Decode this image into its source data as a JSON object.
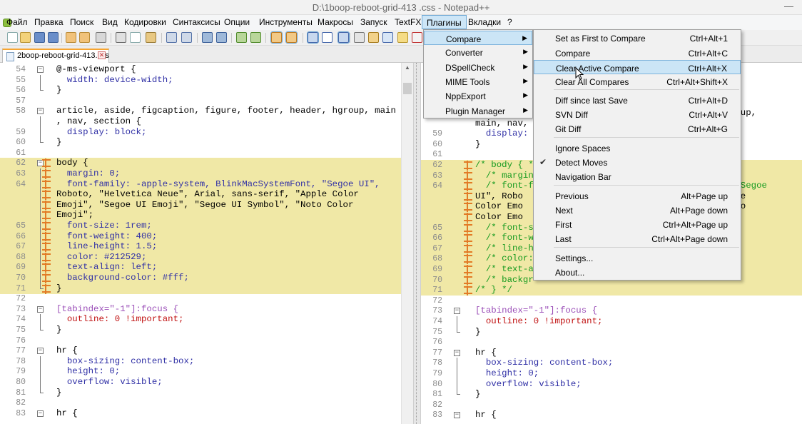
{
  "window": {
    "title": "D:\\1boop-reboot-grid-413 .css - Notepad++"
  },
  "menubar": [
    "Файл",
    "Правка",
    "Поиск",
    "Вид",
    "Кодировки",
    "Синтаксисы",
    "Опции",
    "Инструменты",
    "Макросы",
    "Запуск",
    "TextFX",
    "Плагины",
    "Вкладки",
    "?"
  ],
  "tab": {
    "label": "2boop-reboot-grid-413.css"
  },
  "plugins_menu": [
    {
      "label": "Compare",
      "arrow": "▶"
    },
    {
      "label": "Converter",
      "arrow": "▶"
    },
    {
      "label": "DSpellCheck",
      "arrow": "▶"
    },
    {
      "label": "MIME Tools",
      "arrow": "▶"
    },
    {
      "label": "NppExport",
      "arrow": "▶"
    },
    {
      "label": "Plugin Manager",
      "arrow": "▶"
    }
  ],
  "compare_menu": [
    {
      "label": "Set as First to Compare",
      "shortcut": "Ctrl+Alt+1"
    },
    {
      "label": "Compare",
      "shortcut": "Ctrl+Alt+C"
    },
    {
      "label": "Clear Active Compare",
      "shortcut": "Ctrl+Alt+X"
    },
    {
      "label": "Clear All Compares",
      "shortcut": "Ctrl+Alt+Shift+X"
    },
    {
      "label": "Diff since last Save",
      "shortcut": "Ctrl+Alt+D"
    },
    {
      "label": "SVN Diff",
      "shortcut": "Ctrl+Alt+V"
    },
    {
      "label": "Git Diff",
      "shortcut": "Ctrl+Alt+G"
    },
    {
      "label": "Ignore Spaces",
      "shortcut": ""
    },
    {
      "label": "Detect Moves",
      "shortcut": ""
    },
    {
      "label": "Navigation Bar",
      "shortcut": ""
    },
    {
      "label": "Previous",
      "shortcut": "Alt+Page up"
    },
    {
      "label": "Next",
      "shortcut": "Alt+Page down"
    },
    {
      "label": "First",
      "shortcut": "Ctrl+Alt+Page up"
    },
    {
      "label": "Last",
      "shortcut": "Ctrl+Alt+Page down"
    },
    {
      "label": "Settings...",
      "shortcut": ""
    },
    {
      "label": "About...",
      "shortcut": ""
    }
  ],
  "checkmark": "✔",
  "left_lines": [
    {
      "n": "54",
      "t": "@-ms-viewport {"
    },
    {
      "n": "55",
      "t": "  width: device-width;"
    },
    {
      "n": "56",
      "t": "}"
    },
    {
      "n": "57",
      "t": ""
    },
    {
      "n": "58",
      "t": "article, aside, figcaption, figure, footer, header, hgroup, main"
    },
    {
      "n": "",
      "t": ", nav, section {"
    },
    {
      "n": "59",
      "t": "  display: block;"
    },
    {
      "n": "60",
      "t": "}"
    },
    {
      "n": "61",
      "t": ""
    },
    {
      "n": "62",
      "t": "body {"
    },
    {
      "n": "63",
      "t": "  margin: 0;"
    },
    {
      "n": "64",
      "t": "  font-family: -apple-system, BlinkMacSystemFont, \"Segoe UI\","
    },
    {
      "n": "",
      "t": "Roboto, \"Helvetica Neue\", Arial, sans-serif, \"Apple Color"
    },
    {
      "n": "",
      "t": "Emoji\", \"Segoe UI Emoji\", \"Segoe UI Symbol\", \"Noto Color"
    },
    {
      "n": "",
      "t": "Emoji\";"
    },
    {
      "n": "65",
      "t": "  font-size: 1rem;"
    },
    {
      "n": "66",
      "t": "  font-weight: 400;"
    },
    {
      "n": "67",
      "t": "  line-height: 1.5;"
    },
    {
      "n": "68",
      "t": "  color: #212529;"
    },
    {
      "n": "69",
      "t": "  text-align: left;"
    },
    {
      "n": "70",
      "t": "  background-color: #fff;"
    },
    {
      "n": "71",
      "t": "}"
    },
    {
      "n": "72",
      "t": ""
    },
    {
      "n": "73",
      "t": "[tabindex=\"-1\"]:focus {"
    },
    {
      "n": "74",
      "t": "  outline: 0 !important;"
    },
    {
      "n": "75",
      "t": "}"
    },
    {
      "n": "76",
      "t": ""
    },
    {
      "n": "77",
      "t": "hr {"
    },
    {
      "n": "78",
      "t": "  box-sizing: content-box;"
    },
    {
      "n": "79",
      "t": "  height: 0;"
    },
    {
      "n": "80",
      "t": "  overflow: visible;"
    },
    {
      "n": "81",
      "t": "}"
    },
    {
      "n": "82",
      "t": ""
    },
    {
      "n": "83",
      "t": "hr {"
    }
  ],
  "right_lines": [
    {
      "n": "",
      "t": "                                              hgroup,"
    },
    {
      "n": "",
      "t": "main, nav,"
    },
    {
      "n": "59",
      "t": "  display:"
    },
    {
      "n": "60",
      "t": "}"
    },
    {
      "n": "61",
      "t": ""
    },
    {
      "n": "62",
      "t": "/* body { */"
    },
    {
      "n": "63",
      "t": "  /* margin"
    },
    {
      "n": "64",
      "t": "  /* font-f                                    , \"Segoe"
    },
    {
      "n": "",
      "t": "UI\", Robo                                    \"Apple"
    },
    {
      "n": "",
      "t": "Color Emo                                   , \"Noto"
    },
    {
      "n": "",
      "t": "Color Emo"
    },
    {
      "n": "65",
      "t": "  /* font-s"
    },
    {
      "n": "66",
      "t": "  /* font-w"
    },
    {
      "n": "67",
      "t": "  /* line-h"
    },
    {
      "n": "68",
      "t": "  /* color:"
    },
    {
      "n": "69",
      "t": "  /* text-a"
    },
    {
      "n": "70",
      "t": "  /* backgr"
    },
    {
      "n": "71",
      "t": "/* } */"
    },
    {
      "n": "72",
      "t": ""
    },
    {
      "n": "73",
      "t": "[tabindex=\"-1\"]:focus {"
    },
    {
      "n": "74",
      "t": "  outline: 0 !important;"
    },
    {
      "n": "75",
      "t": "}"
    },
    {
      "n": "76",
      "t": ""
    },
    {
      "n": "77",
      "t": "hr {"
    },
    {
      "n": "78",
      "t": "  box-sizing: content-box;"
    },
    {
      "n": "79",
      "t": "  height: 0;"
    },
    {
      "n": "80",
      "t": "  overflow: visible;"
    },
    {
      "n": "81",
      "t": "}"
    },
    {
      "n": "82",
      "t": ""
    },
    {
      "n": "83",
      "t": "hr {"
    }
  ]
}
